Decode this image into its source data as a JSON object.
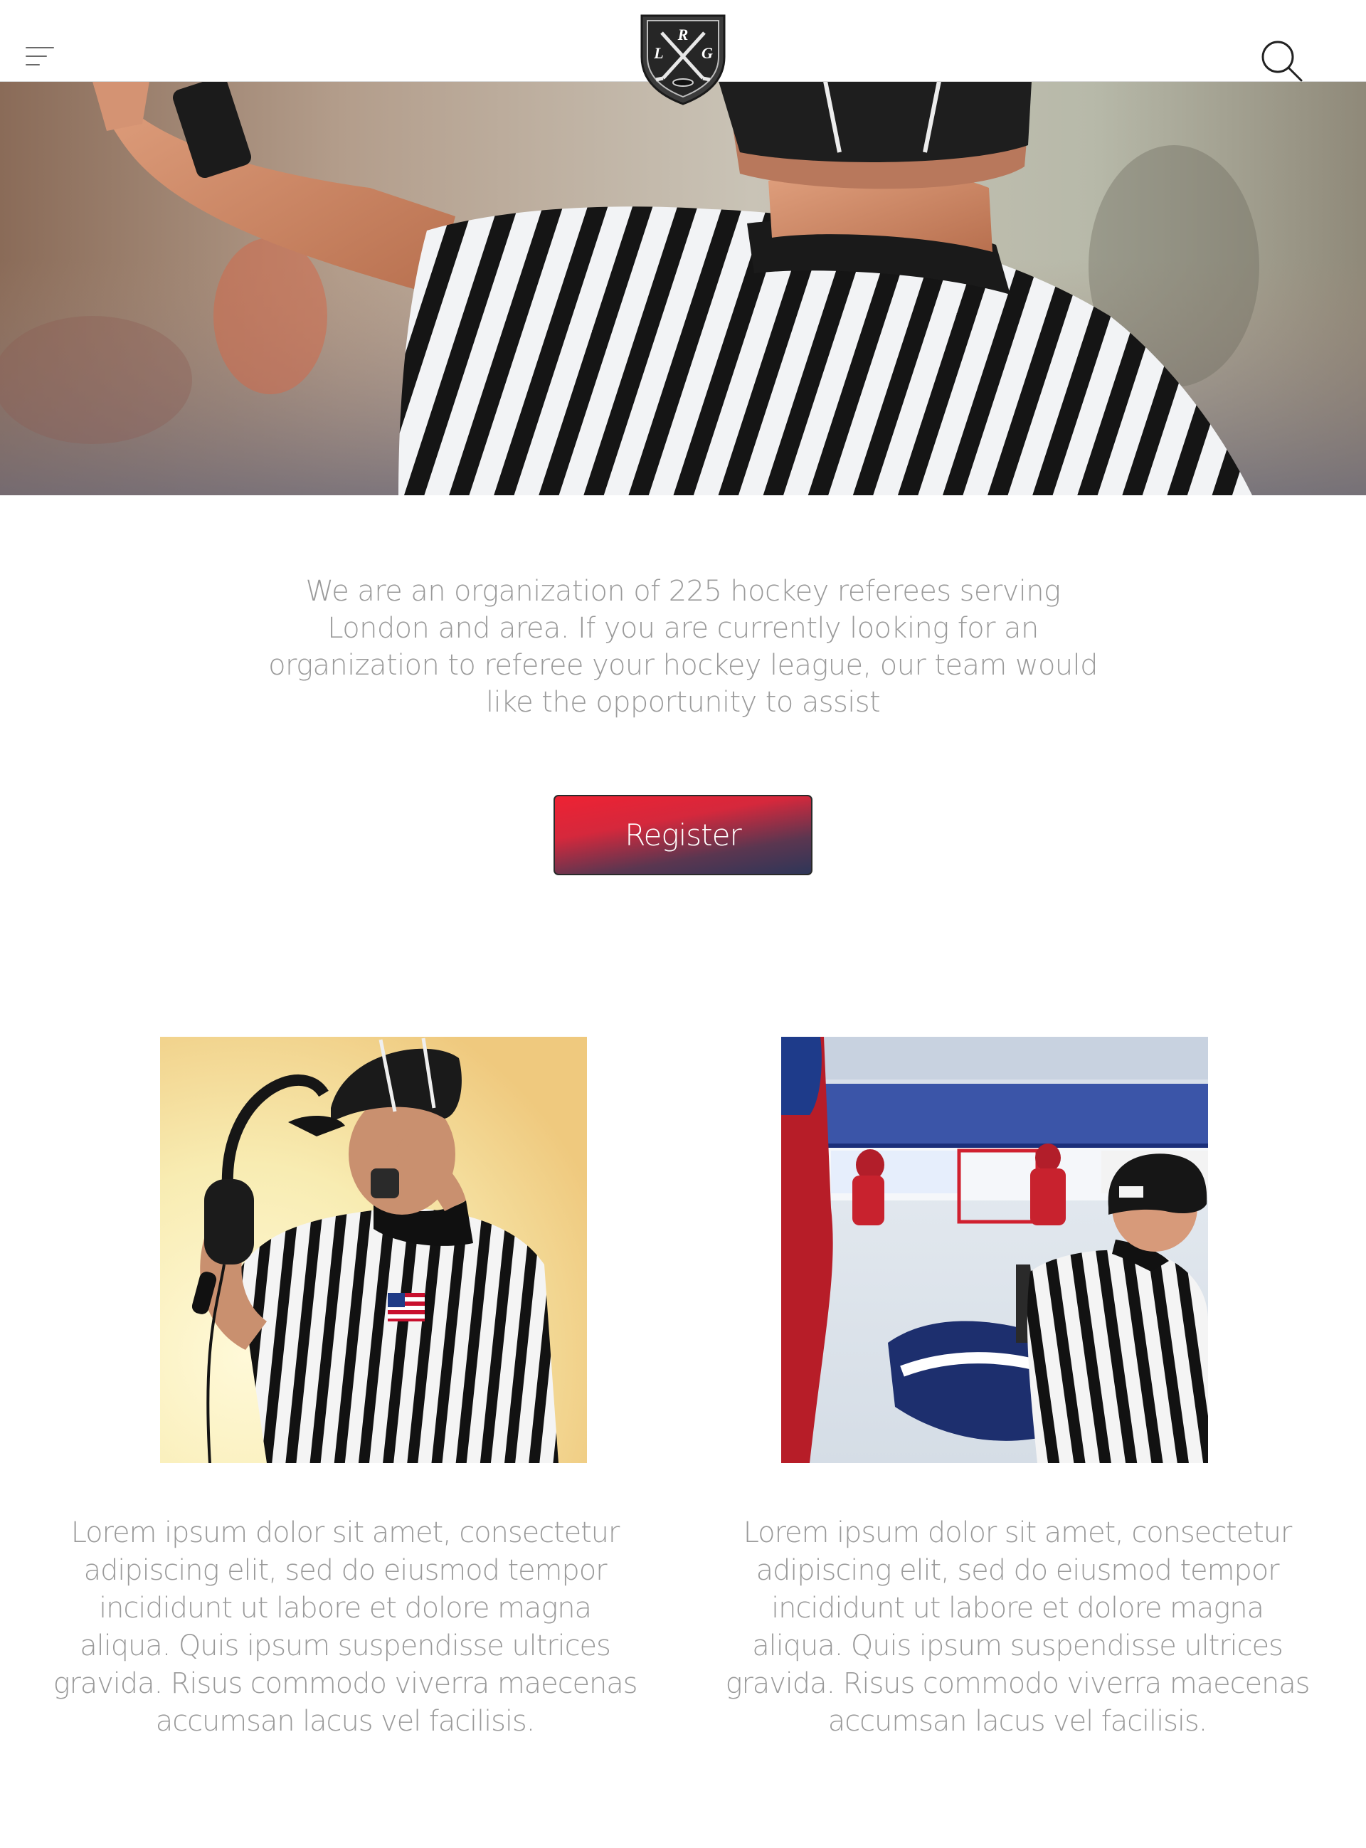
{
  "header": {
    "menu_icon": "hamburger-menu-icon",
    "logo_letters": [
      "R",
      "L",
      "G"
    ],
    "search_icon": "search-icon"
  },
  "intro": {
    "text": "We are an organization of 225 hockey referees serving London and area. If you are currently looking for an organization to referee your hockey league, our team would like the opportunity to assist"
  },
  "register_button": {
    "label": "Register"
  },
  "features": [
    {
      "text": "Lorem ipsum dolor sit amet, consectetur adipiscing elit, sed do eiusmod tempor incididunt ut labore et dolore magna aliqua. Quis ipsum suspendisse ultrices gravida. Risus commodo viverra maecenas accumsan lacus vel facilisis."
    },
    {
      "text": "Lorem ipsum dolor sit amet, consectetur adipiscing elit, sed do eiusmod tempor incididunt ut labore et dolore magna aliqua. Quis ipsum suspendisse ultrices gravida. Risus commodo viverra maecenas accumsan lacus vel facilisis."
    }
  ],
  "colors": {
    "button_gradient_top": "#ee2233",
    "button_gradient_bottom": "#2e3658",
    "body_text": "#9a9a9a"
  }
}
